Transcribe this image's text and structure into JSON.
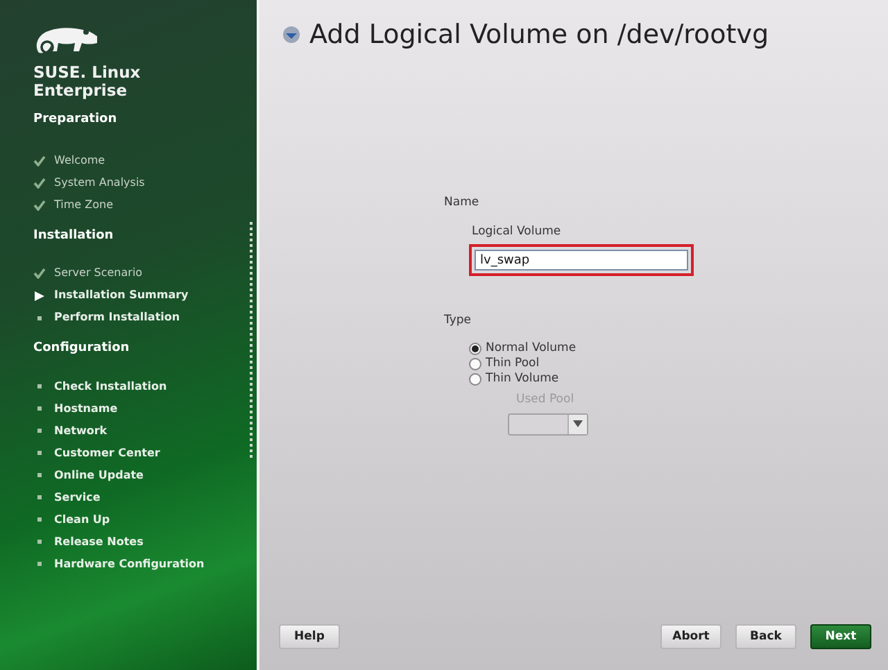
{
  "sidebar": {
    "brand": "SUSE. Linux Enterprise",
    "sections": [
      {
        "title": "Preparation",
        "items": [
          {
            "label": "Welcome",
            "kind": "done"
          },
          {
            "label": "System Analysis",
            "kind": "done"
          },
          {
            "label": "Time Zone",
            "kind": "done"
          }
        ]
      },
      {
        "title": "Installation",
        "items": [
          {
            "label": "Server Scenario",
            "kind": "done"
          },
          {
            "label": "Installation Summary",
            "kind": "current"
          },
          {
            "label": "Perform Installation",
            "kind": "pending"
          }
        ]
      },
      {
        "title": "Configuration",
        "items": [
          {
            "label": "Check Installation",
            "kind": "pending"
          },
          {
            "label": "Hostname",
            "kind": "pending"
          },
          {
            "label": "Network",
            "kind": "pending"
          },
          {
            "label": "Customer Center",
            "kind": "pending"
          },
          {
            "label": "Online Update",
            "kind": "pending"
          },
          {
            "label": "Service",
            "kind": "pending"
          },
          {
            "label": "Clean Up",
            "kind": "pending"
          },
          {
            "label": "Release Notes",
            "kind": "pending"
          },
          {
            "label": "Hardware Configuration",
            "kind": "pending"
          }
        ]
      }
    ]
  },
  "dialog": {
    "title": "Add Logical Volume on /dev/rootvg",
    "name_group": {
      "label": "Name",
      "field": {
        "label": "Logical Volume",
        "value": "lv_swap",
        "highlighted": true
      }
    },
    "type_group": {
      "label": "Type",
      "options": [
        {
          "label": "Normal Volume",
          "selected": true
        },
        {
          "label": "Thin Pool",
          "selected": false
        },
        {
          "label": "Thin Volume",
          "selected": false
        }
      ],
      "used_pool": {
        "label": "Used Pool",
        "disabled": true
      }
    }
  },
  "buttons": [
    {
      "label": "Help",
      "kind": "left",
      "primary": false
    },
    {
      "label": "Abort",
      "kind": "right",
      "primary": false
    },
    {
      "label": "Back",
      "kind": "right",
      "primary": false
    },
    {
      "label": "Next",
      "kind": "right",
      "primary": true
    }
  ]
}
